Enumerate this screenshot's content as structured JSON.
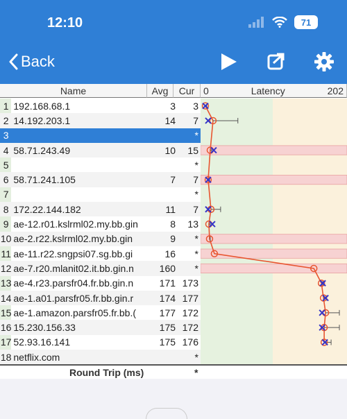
{
  "status_bar": {
    "time": "12:10",
    "battery": "71"
  },
  "nav": {
    "back_label": "Back"
  },
  "columns": {
    "name": "Name",
    "avg": "Avg",
    "cur": "Cur",
    "axis_min": "0",
    "latency": "Latency",
    "axis_max": "202"
  },
  "rows": [
    {
      "num": "1",
      "host": "192.168.68.1",
      "avg": "3",
      "cur": "3"
    },
    {
      "num": "2",
      "host": "14.192.203.1",
      "avg": "14",
      "cur": "7"
    },
    {
      "num": "3",
      "host": "",
      "avg": "",
      "cur": "*"
    },
    {
      "num": "4",
      "host": "58.71.243.49",
      "avg": "10",
      "cur": "15"
    },
    {
      "num": "5",
      "host": "",
      "avg": "",
      "cur": "*"
    },
    {
      "num": "6",
      "host": "58.71.241.105",
      "avg": "7",
      "cur": "7"
    },
    {
      "num": "7",
      "host": "",
      "avg": "",
      "cur": "*"
    },
    {
      "num": "8",
      "host": "172.22.144.182",
      "avg": "11",
      "cur": "7"
    },
    {
      "num": "9",
      "host": "ae-12.r01.kslrml02.my.bb.gin",
      "avg": "8",
      "cur": "13"
    },
    {
      "num": "10",
      "host": "ae-2.r22.kslrml02.my.bb.gin",
      "avg": "9",
      "cur": "*"
    },
    {
      "num": "11",
      "host": "ae-11.r22.sngpsi07.sg.bb.gi",
      "avg": "16",
      "cur": "*"
    },
    {
      "num": "12",
      "host": "ae-7.r20.mlanit02.it.bb.gin.n",
      "avg": "160",
      "cur": "*"
    },
    {
      "num": "13",
      "host": "ae-4.r23.parsfr04.fr.bb.gin.n",
      "avg": "171",
      "cur": "173"
    },
    {
      "num": "14",
      "host": "ae-1.a01.parsfr05.fr.bb.gin.r",
      "avg": "174",
      "cur": "177"
    },
    {
      "num": "15",
      "host": "ae-1.amazon.parsfr05.fr.bb.(",
      "avg": "177",
      "cur": "172"
    },
    {
      "num": "16",
      "host": "15.230.156.33",
      "avg": "175",
      "cur": "172"
    },
    {
      "num": "17",
      "host": "52.93.16.141",
      "avg": "175",
      "cur": "176"
    },
    {
      "num": "18",
      "host": "netflix.com",
      "avg": "",
      "cur": "*"
    }
  ],
  "footer": {
    "label": "Round Trip (ms)",
    "cur": "*"
  },
  "chart_data": {
    "type": "line",
    "x_axis_range": [
      0,
      202
    ],
    "avg": [
      3,
      14,
      null,
      10,
      null,
      7,
      null,
      11,
      8,
      9,
      16,
      160,
      171,
      174,
      177,
      175,
      175,
      null
    ],
    "cur": [
      3,
      7,
      null,
      15,
      null,
      7,
      null,
      7,
      13,
      null,
      null,
      null,
      173,
      177,
      172,
      172,
      176,
      null
    ],
    "max": [
      5,
      50,
      null,
      12,
      null,
      9,
      null,
      25,
      10,
      10,
      16,
      160,
      173,
      178,
      197,
      197,
      185,
      null
    ],
    "loss_rows": [
      4,
      6,
      10,
      11,
      12
    ],
    "selected_row": 3,
    "colors": {
      "line": "#e85530",
      "cur_marker": "#3434c8",
      "loss_band": "#f7d2d2",
      "zone_green": "#e6f2df",
      "zone_yellow": "#fbf1dc"
    }
  }
}
